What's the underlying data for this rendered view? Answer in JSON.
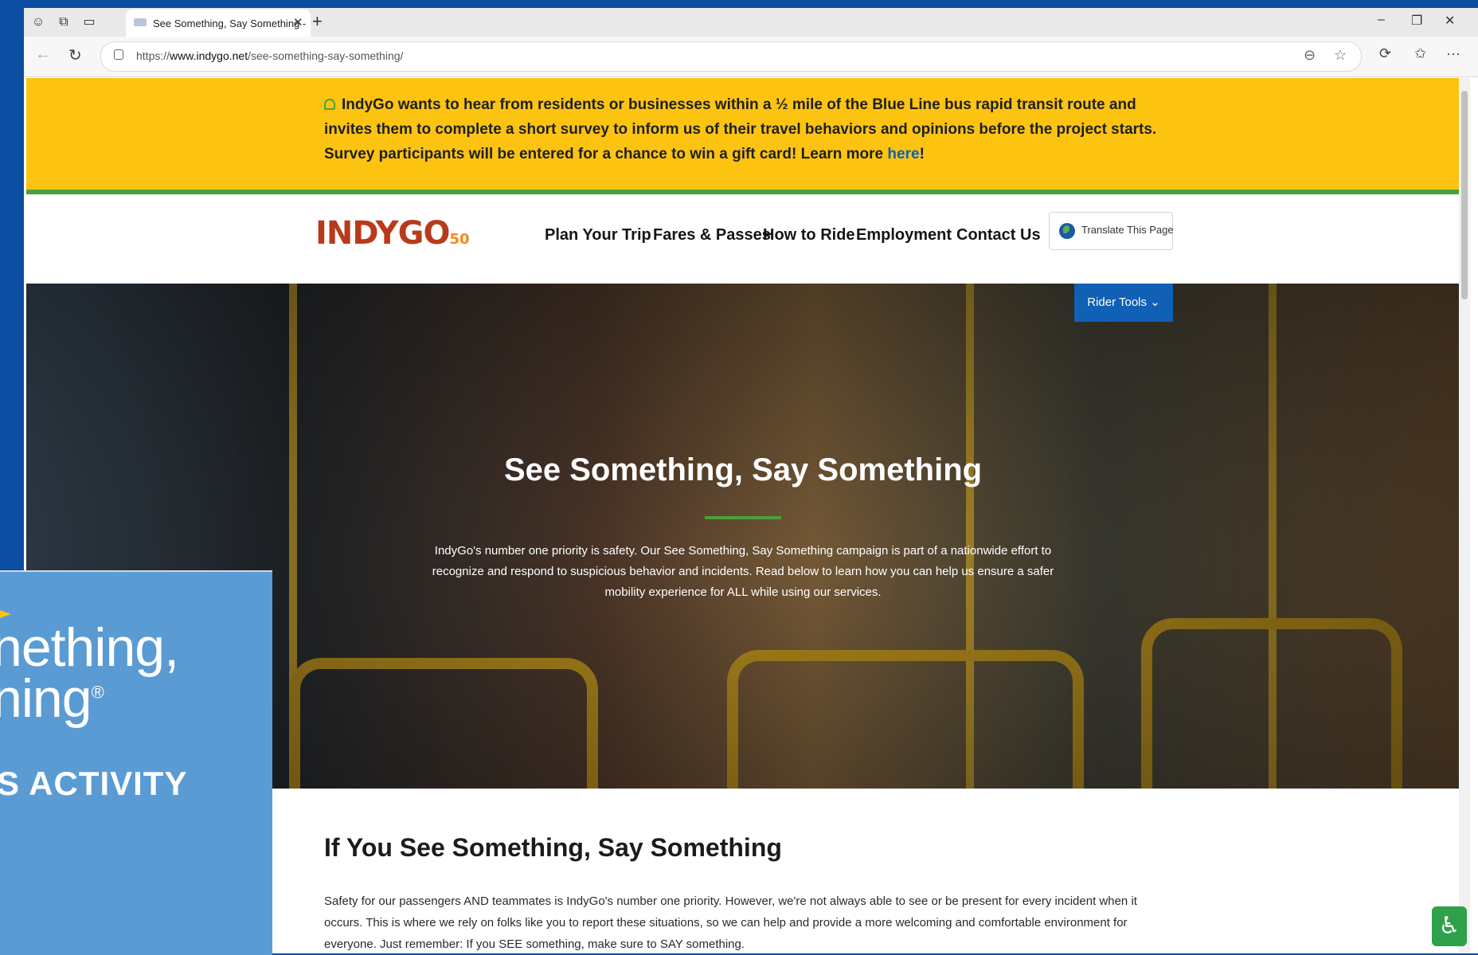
{
  "browser": {
    "tab_title": "See Something, Say Something -",
    "url_prefix": "https://",
    "url_domain": "www.indygo.net",
    "url_path": "/see-something-say-something/"
  },
  "banner": {
    "text": "IndyGo wants to hear from residents or businesses within a ½ mile of the Blue Line bus rapid transit route and invites them to complete a short survey to inform us of their travel behaviors and opinions before the project starts. Survey participants will be entered for a chance to win a gift card! Learn more ",
    "link_text": "here",
    "end": "!"
  },
  "header": {
    "logo_main": "INDYGO",
    "logo_sub": "50",
    "menu": [
      "Plan Your Trip",
      "Fares & Passes",
      "How to Ride",
      "Employment",
      "Contact Us"
    ],
    "translate_label": "Translate This Page"
  },
  "hero": {
    "rider_tools": "Rider Tools",
    "title": "See Something, Say Something",
    "body": "IndyGo's number one priority is safety. Our See Something, Say Something campaign is part of a nationwide effort to recognize and respond to suspicious behavior and incidents. Read below to learn how you can help us ensure a safer mobility experience for ALL while using our services."
  },
  "content": {
    "heading": "If You See Something, Say Something",
    "body": "Safety for our passengers AND teammates is IndyGo's number one priority. However, we're not always able to see or be present for every incident when it occurs. This is where we rely on folks like you to report these situations, so we can help and provide a more welcoming and comfortable environment for everyone. Just remember: If you SEE something, make sure to SAY something."
  },
  "overlay": {
    "line1": "nething,",
    "line2": "ning",
    "mark": "®",
    "line3": "S ACTIVITY"
  },
  "colors": {
    "banner": "#fcc411",
    "accent_green": "#4ca03c",
    "link_blue": "#1060b5",
    "overlay_blue": "#5a9bd4"
  }
}
